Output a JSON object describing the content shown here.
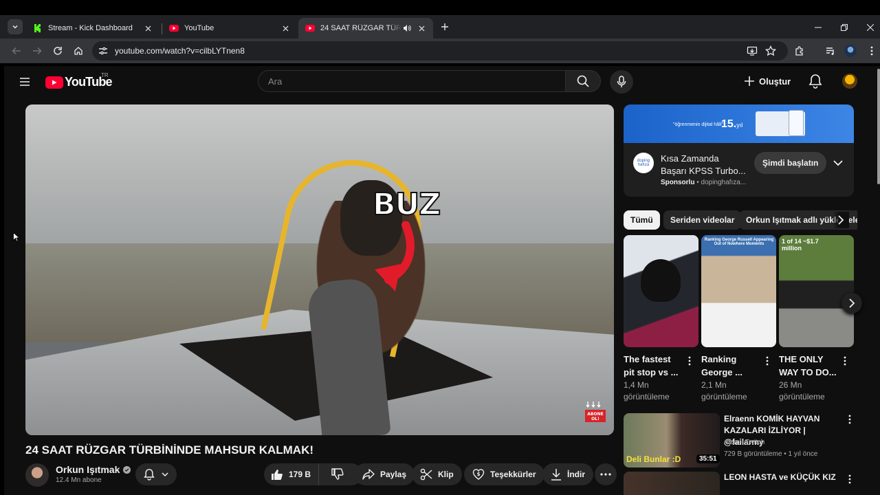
{
  "browser": {
    "tabs": [
      {
        "title": "Stream - Kick Dashboard",
        "favicon": "kick-icon",
        "color": "#53fc18"
      },
      {
        "title": "YouTube",
        "favicon": "youtube-icon",
        "color": "#ff0033"
      },
      {
        "title": "24 SAAT RÜZGAR TÜRBİNİ",
        "favicon": "youtube-icon",
        "color": "#ff0033",
        "audio": true
      }
    ],
    "url": "youtube.com/watch?v=cilbLYTnen8"
  },
  "youtube": {
    "logo_text": "YouTube",
    "country_code": "TR",
    "search_placeholder": "Ara",
    "create_label": "Oluştur",
    "brand_color": "#ff0033"
  },
  "video": {
    "overlay_text": "BUZ",
    "title": "24 SAAT RÜZGAR TÜRBİNİNDE MAHSUR KALMAK!",
    "channel": "Orkun Işıtmak",
    "subscribers": "12.4 Mn abone",
    "likes": "179 B",
    "actions": {
      "share": "Paylaş",
      "clip": "Klip",
      "thanks": "Teşekkürler",
      "download": "İndir"
    },
    "subscribe_badge": "ABONE OL!"
  },
  "ad": {
    "slogan": "\"öğrenmenin dijital hâli\"",
    "year": "15.",
    "year_suffix": "yıl",
    "logo_text": "doping hafıza",
    "title_line1": "Kısa Zamanda",
    "title_line2": "Başarı KPSS Turbo...",
    "sponsored": "Sponsorlu",
    "advertiser": "dopinghafıza...",
    "cta": "Şimdi başlatın"
  },
  "chips": [
    "Tümü",
    "Seriden videolar",
    "Orkun Işıtmak adlı yüklemeler"
  ],
  "shorts": [
    {
      "title_l1": "The fastest",
      "title_l2": "pit stop vs ...",
      "views_l1": "1,4 Mn",
      "views_l2": "görüntüleme",
      "thumb_text": ""
    },
    {
      "title_l1": "Ranking",
      "title_l2": "George ...",
      "views_l1": "2,1 Mn",
      "views_l2": "görüntüleme",
      "thumb_text": "Ranking George Russell Appearing Out of Nowhere Moments"
    },
    {
      "title_l1": "THE ONLY",
      "title_l2": "WAY TO DO...",
      "views_l1": "26 Mn",
      "views_l2": "görüntüleme",
      "thumb_text": "1 of 14 ~$1.7 million"
    }
  ],
  "recommendations": [
    {
      "title_l1": "Elraenn KOMİK HAYVAN",
      "title_l2": "KAZALARI İZLİYOR | @failarmy",
      "channel": "Alem-i Twitch",
      "meta": "729 B görüntüleme • 1 yıl önce",
      "duration": "35:51",
      "thumb_text": "Deli Bunlar :D"
    },
    {
      "title_l1": "LEON HASTA ve KÜÇÜK KIZ"
    }
  ]
}
